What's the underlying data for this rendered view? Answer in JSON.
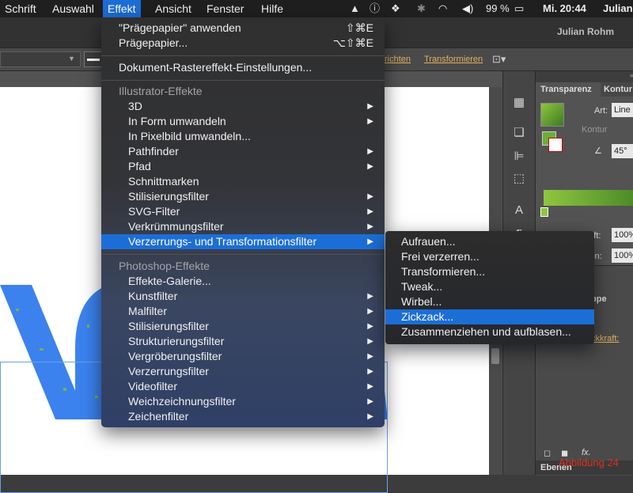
{
  "menubar": {
    "items": [
      "Schrift",
      "Auswahl",
      "Effekt",
      "Ansicht",
      "Fenster",
      "Hilfe"
    ],
    "battery": "99 %",
    "clock": "Mi. 20:44",
    "user_short": "Julian"
  },
  "app": {
    "user_name": "Julian Rohm",
    "control_links": [
      "richten",
      "Transformieren"
    ]
  },
  "effekt_menu": {
    "top_items": [
      {
        "label": "\"Prägepapier\" anwenden",
        "shortcut": "⇧⌘E"
      },
      {
        "label": "Prägepapier...",
        "shortcut": "⌥⇧⌘E"
      }
    ],
    "doc_item": "Dokument-Rastereffekt-Einstellungen...",
    "illustrator_header": "Illustrator-Effekte",
    "illustrator_items": [
      {
        "label": "3D",
        "submenu": true
      },
      {
        "label": "In Form umwandeln",
        "submenu": true
      },
      {
        "label": "In Pixelbild umwandeln...",
        "submenu": false
      },
      {
        "label": "Pathfinder",
        "submenu": true
      },
      {
        "label": "Pfad",
        "submenu": true
      },
      {
        "label": "Schnittmarken",
        "submenu": false
      },
      {
        "label": "Stilisierungsfilter",
        "submenu": true
      },
      {
        "label": "SVG-Filter",
        "submenu": true
      },
      {
        "label": "Verkrümmungsfilter",
        "submenu": true
      },
      {
        "label": "Verzerrungs- und Transformationsfilter",
        "submenu": true
      }
    ],
    "photoshop_header": "Photoshop-Effekte",
    "photoshop_items": [
      {
        "label": "Effekte-Galerie...",
        "submenu": false
      },
      {
        "label": "Kunstfilter",
        "submenu": true
      },
      {
        "label": "Malfilter",
        "submenu": true
      },
      {
        "label": "Stilisierungsfilter",
        "submenu": true
      },
      {
        "label": "Strukturierungsfilter",
        "submenu": true
      },
      {
        "label": "Vergröberungsfilter",
        "submenu": true
      },
      {
        "label": "Verzerrungsfilter",
        "submenu": true
      },
      {
        "label": "Videofilter",
        "submenu": true
      },
      {
        "label": "Weichzeichnungsfilter",
        "submenu": true
      },
      {
        "label": "Zeichenfilter",
        "submenu": true
      }
    ]
  },
  "submenu": {
    "items": [
      "Aufrauen...",
      "Frei verzerren...",
      "Transformieren...",
      "Tweak...",
      "Wirbel...",
      "Zickzack...",
      "Zusammenziehen und aufblasen..."
    ]
  },
  "panel": {
    "tabs": [
      "Transparenz",
      "Kontur"
    ],
    "art_label": "Art:",
    "art_value": "Line",
    "kontur_label": "Kontur",
    "angle_value": "45°",
    "deckkraft_label": "kraft:",
    "deckkraft_value": "100%",
    "position_label": "ion:",
    "position_value": "100%",
    "lower_label_1": "ppe",
    "lower_label_2": "t",
    "lower_label_3": "ckkraft:",
    "layers_tab": "Ebenen"
  },
  "caption": "Abbildung 24",
  "colors": {
    "menu_highlight": "#1c6ed7",
    "fill_green": "#8fc63f",
    "art_blue": "#3b82ee",
    "caption_red": "#e0301e"
  }
}
